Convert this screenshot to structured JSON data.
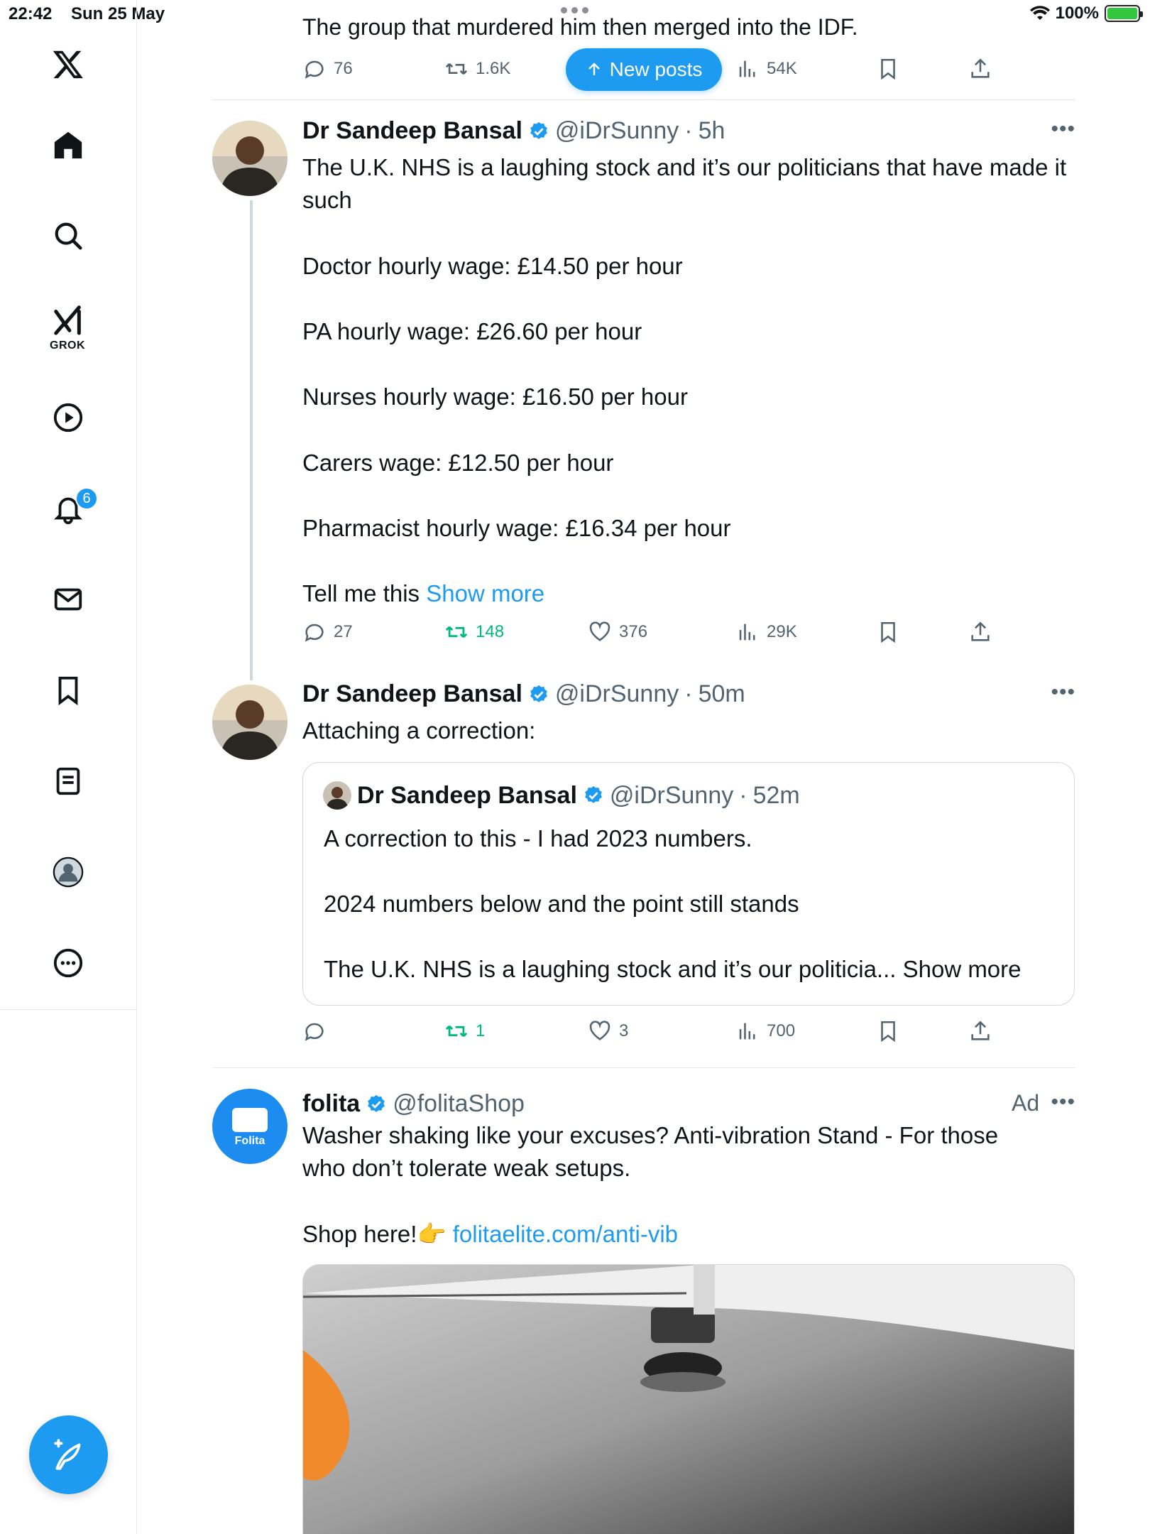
{
  "status_bar": {
    "time": "22:42",
    "date": "Sun 25 May",
    "battery": "100%"
  },
  "sidebar": {
    "grok_label": "GROK",
    "notifications_badge": "6",
    "items": [
      {
        "icon": "x-logo-icon"
      },
      {
        "icon": "home-icon"
      },
      {
        "icon": "search-icon"
      },
      {
        "icon": "grok-icon"
      },
      {
        "icon": "video-icon"
      },
      {
        "icon": "notifications-icon"
      },
      {
        "icon": "messages-icon"
      },
      {
        "icon": "bookmarks-icon"
      },
      {
        "icon": "lists-icon"
      },
      {
        "icon": "profile-icon"
      },
      {
        "icon": "more-icon"
      }
    ]
  },
  "new_posts_label": "New posts",
  "previous_post": {
    "text": "The group that murdered him then merged into the IDF.",
    "replies": "76",
    "reposts": "1.6K",
    "views": "54K"
  },
  "post1": {
    "name": "Dr Sandeep Bansal",
    "handle": "@iDrSunny",
    "time": "5h",
    "lines": [
      "The U.K. NHS is a laughing stock and it’s our politicians that have made it such",
      "Doctor hourly wage: £14.50 per hour",
      "PA hourly wage: £26.60 per hour",
      "Nurses hourly wage: £16.50 per hour",
      "Carers wage: £12.50 per hour",
      "Pharmacist hourly wage: £16.34 per hour",
      "Tell me this"
    ],
    "show_more": "Show more",
    "replies": "27",
    "reposts": "148",
    "likes": "376",
    "views": "29K"
  },
  "post2": {
    "name": "Dr Sandeep Bansal",
    "handle": "@iDrSunny",
    "time": "50m",
    "text": "Attaching a correction:",
    "reposts": "1",
    "likes": "3",
    "views": "700",
    "quote": {
      "name": "Dr Sandeep Bansal",
      "handle": "@iDrSunny",
      "time": "52m",
      "lines": [
        "A correction to this - I had 2023 numbers.",
        "2024 numbers below and the point still stands",
        "The U.K. NHS is a laughing stock and it’s our politicia... Show more"
      ]
    }
  },
  "ad_post": {
    "name": "folita",
    "handle": "@folitaShop",
    "ad_label": "Ad",
    "avatar_text": "Folita",
    "text": "Washer shaking like your excuses? Anti-vibration Stand - For those who don’t tolerate weak setups.",
    "shop_text": "Shop here!👉",
    "link": "folitaelite.com/anti-vib"
  },
  "colors": {
    "accent": "#1d9bf0",
    "repost_active": "#00ba7c",
    "secondary_text": "#536471"
  }
}
